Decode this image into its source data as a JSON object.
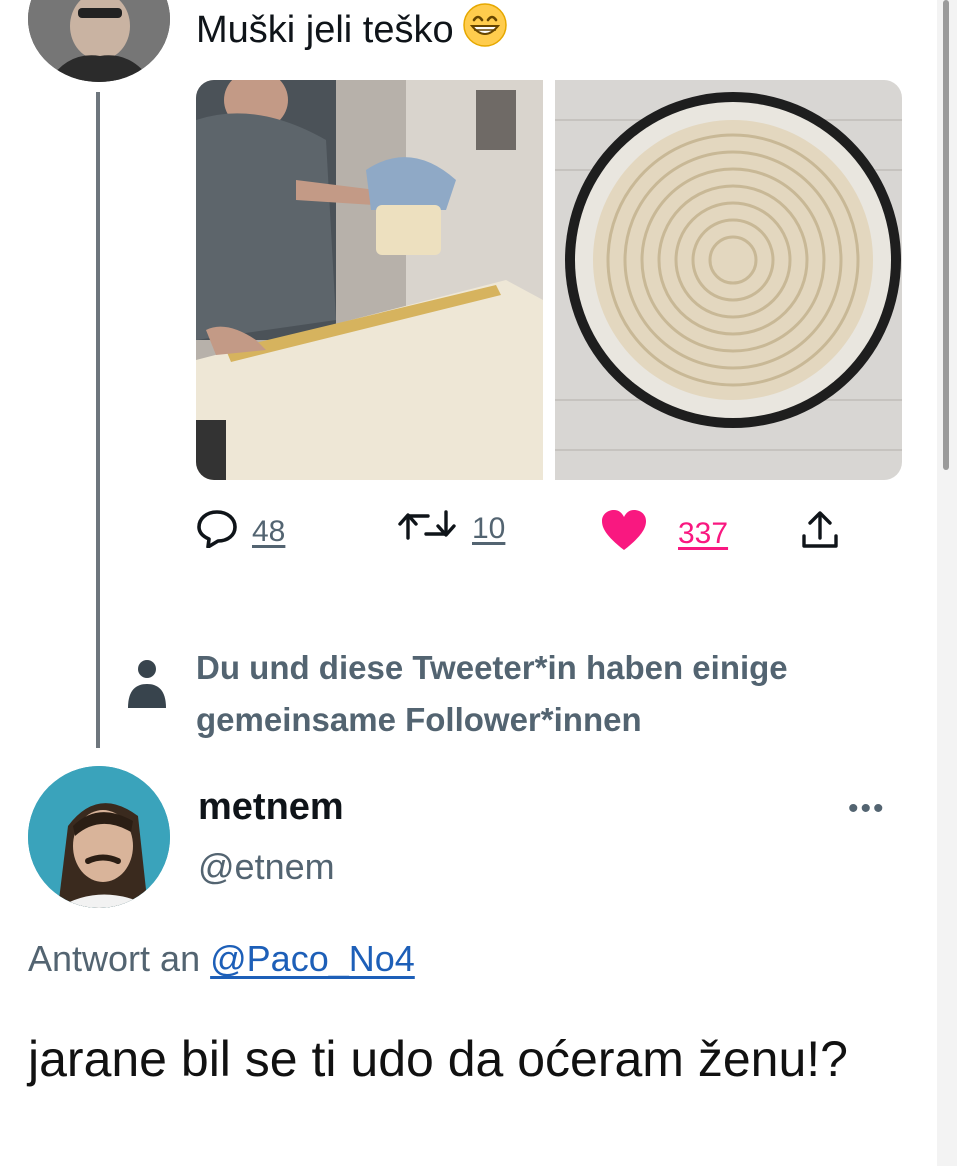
{
  "tweet": {
    "text": "Muški jeli teško",
    "emoji": "grinning-face-with-smiling-eyes",
    "media": [
      "man-pouring-flour-on-table-photo",
      "coiled-dough-in-pan-photo"
    ],
    "stats": {
      "replies": "48",
      "retweets": "10",
      "likes": "337"
    },
    "liked": true
  },
  "mutual_notice": "Du und diese Tweeter*in haben einige gemeinsame Follower*innen",
  "reply": {
    "display_name": "metnem",
    "handle": "@etnem",
    "more_label": "•••",
    "reply_to_label": "Antwort an",
    "reply_to_handle": "@Paco_No4",
    "text": "jarane bil se ti udo da oćeram ženu!?"
  },
  "colors": {
    "like": "#f91880",
    "muted": "#536471",
    "link": "#1d5fb8"
  }
}
